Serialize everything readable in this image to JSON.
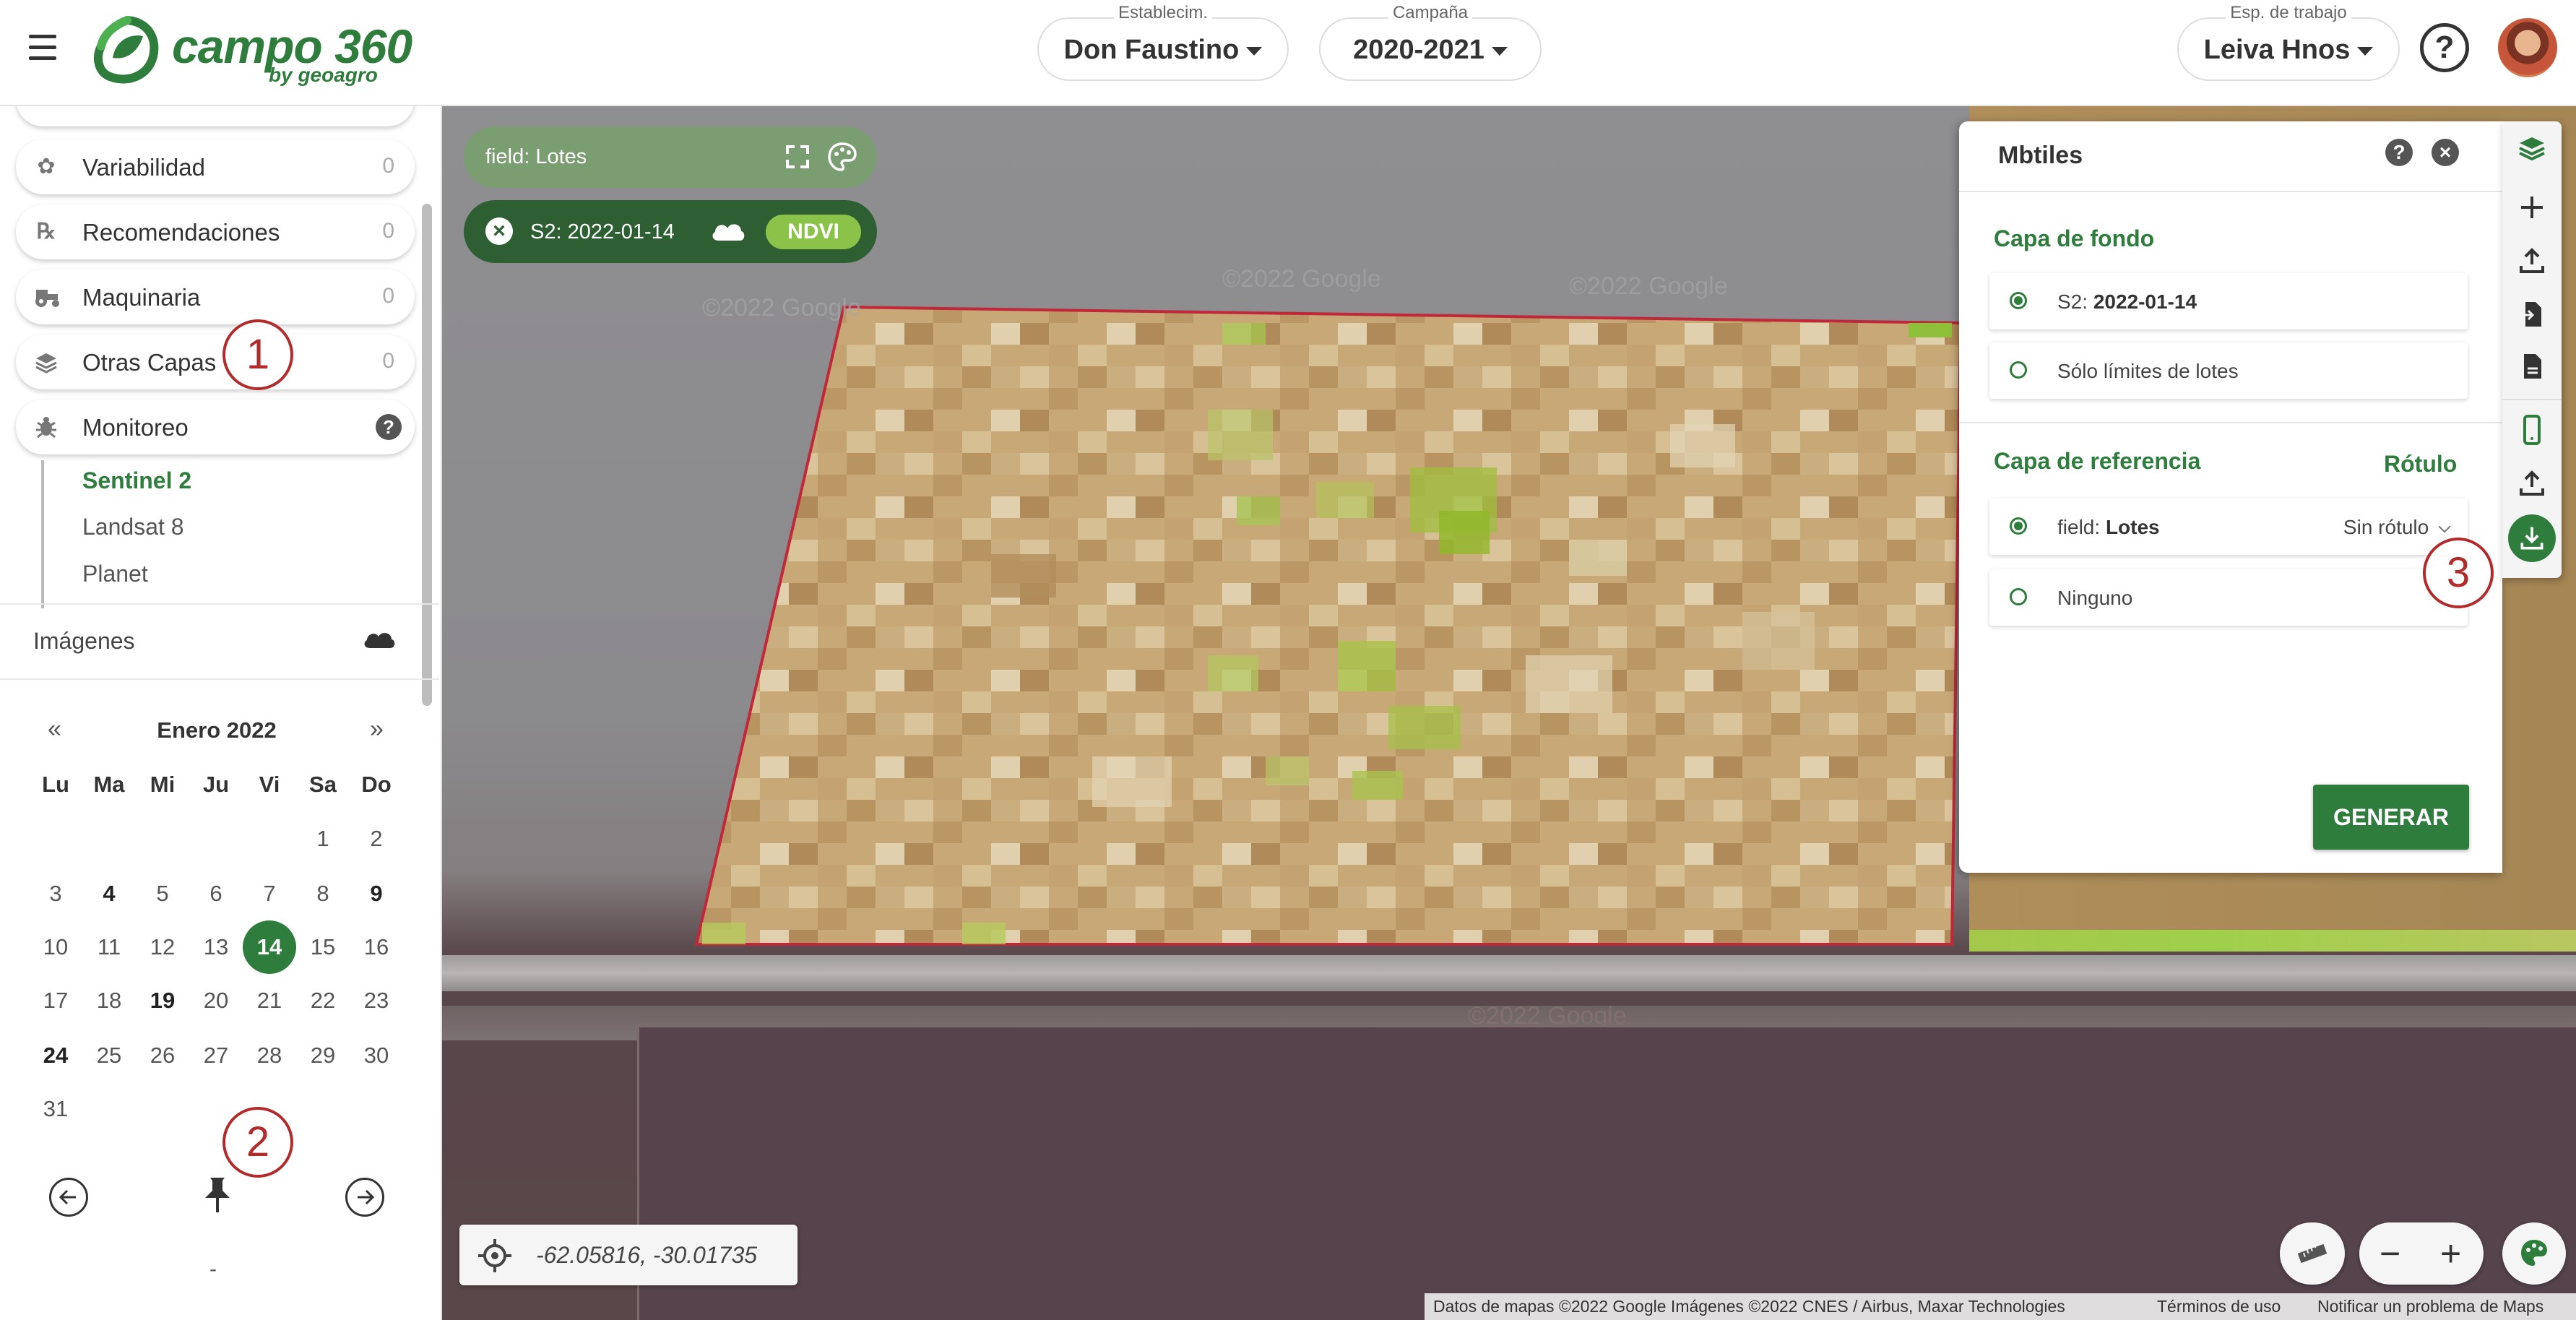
{
  "header": {
    "brand": "campo 360",
    "brand_sub": "by geoagro",
    "establecimiento": {
      "label": "Establecim.",
      "value": "Don Faustino"
    },
    "campana": {
      "label": "Campaña",
      "value": "2020-2021"
    },
    "espacio": {
      "label": "Esp. de trabajo",
      "value": "Leiva Hnos"
    },
    "help": "?"
  },
  "sidebar": {
    "items": [
      {
        "label": "Variabilidad",
        "count": "0",
        "icon": "plant-icon"
      },
      {
        "label": "Recomendaciones",
        "count": "0",
        "icon": "prescription-icon"
      },
      {
        "label": "Maquinaria",
        "count": "0",
        "icon": "tractor-icon"
      },
      {
        "label": "Otras Capas",
        "count": "0",
        "icon": "layers-icon"
      },
      {
        "label": "Monitoreo",
        "count": "",
        "icon": "bug-icon"
      }
    ],
    "monitoreo_help": "?",
    "sub_items": [
      "Sentinel 2",
      "Landsat 8",
      "Planet"
    ],
    "active_sub": "Sentinel 2",
    "images_title": "Imágenes",
    "calendar": {
      "prev": "«",
      "next": "»",
      "month": "Enero 2022",
      "weekdays": [
        "Lu",
        "Ma",
        "Mi",
        "Ju",
        "Vi",
        "Sa",
        "Do"
      ],
      "selected_day": "14",
      "bold_days": [
        "4",
        "9",
        "19",
        "24"
      ],
      "dash": "-"
    }
  },
  "annotations": [
    "1",
    "2",
    "3"
  ],
  "map": {
    "layer_chip": "field: Lotes",
    "image_chip": "S2: 2022-01-14",
    "ndvi": "NDVI",
    "close": "×",
    "coords": "-62.05816, -30.01735",
    "zoom_out": "−",
    "zoom_in": "+",
    "attribution": [
      "Datos de mapas ©2022 Google Imágenes ©2022 CNES / Airbus, Maxar Technologies",
      "Términos de uso",
      "Notificar un problema de Maps"
    ],
    "watermark": "©2022 Google"
  },
  "panel": {
    "title": "Mbtiles",
    "help": "?",
    "close": "×",
    "capa_fondo": "Capa de fondo",
    "fondo_opt1_prefix": "S2:",
    "fondo_opt1_value": "2022-01-14",
    "fondo_opt2": "Sólo límites de lotes",
    "capa_referencia": "Capa de referencia",
    "rotulo": "Rótulo",
    "ref_opt1_prefix": "field:",
    "ref_opt1_value": "Lotes",
    "sin_rotulo": "Sin rótulo",
    "ref_opt2": "Ninguno",
    "generar": "GENERAR"
  },
  "colors": {
    "brand_green": "#2e7d3c",
    "ndvi_green": "#8bc34a",
    "annotation_red": "#b22a2a",
    "field_border": "#c0283a"
  }
}
